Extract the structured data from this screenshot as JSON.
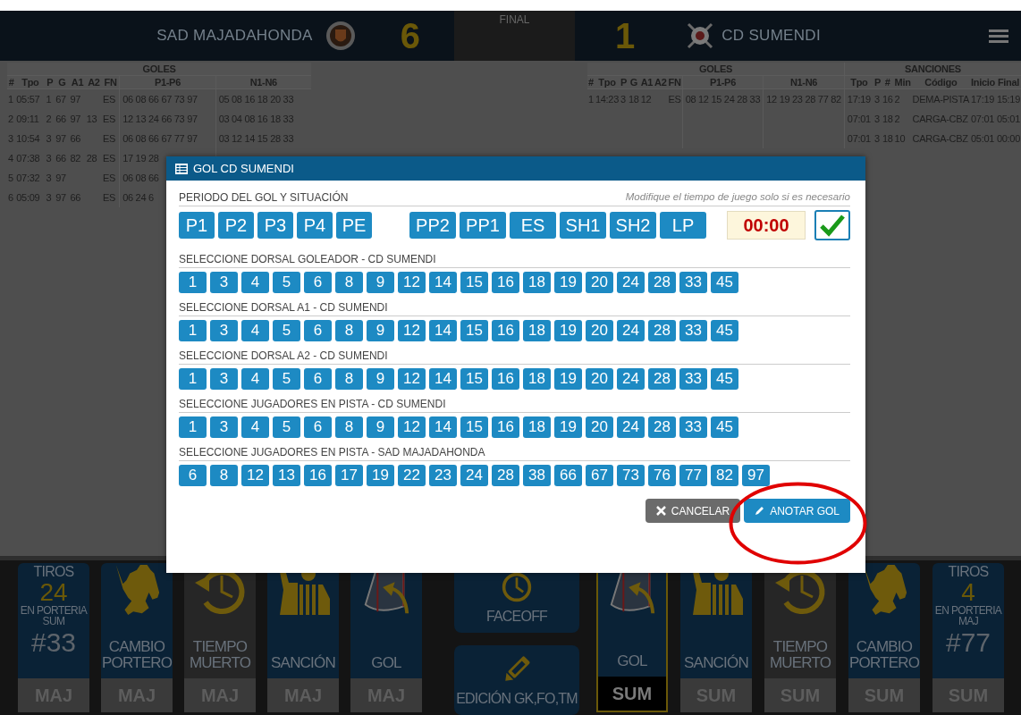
{
  "scoreboard": {
    "home_team": "SAD MAJADAHONDA",
    "home_score": "6",
    "status": "FINAL",
    "away_score": "1",
    "away_team": "CD SUMENDI"
  },
  "home_table": {
    "groups": [
      {
        "label": "GOLES",
        "columns": [
          "#",
          "Tpo",
          "P",
          "G",
          "A1",
          "A2",
          "FN",
          "P1-P6",
          "N1-N6"
        ]
      }
    ],
    "rows": [
      [
        "1",
        "05:57",
        "1",
        "67",
        "97",
        null,
        "ES",
        "06 08 66 67 73 97",
        "05 08 16 18 20 33"
      ],
      [
        "2",
        "09:11",
        "2",
        "66",
        "97",
        "13",
        "ES",
        "12 13 24 66 73 97",
        "03 04 08 16 18 33"
      ],
      [
        "3",
        "10:54",
        "3",
        "97",
        "66",
        null,
        "ES",
        "06 08 66 67 77 97",
        "03 12 14 15 28 33"
      ],
      [
        "4",
        "07:38",
        "3",
        "66",
        "82",
        "28",
        "ES",
        "17 19 28",
        null
      ],
      [
        "5",
        "07:32",
        "3",
        "97",
        null,
        null,
        "ES",
        "06 08 66",
        null
      ],
      [
        "6",
        "05:09",
        "3",
        "97",
        "66",
        null,
        "ES",
        "06 24 6",
        null
      ]
    ]
  },
  "away_table": {
    "groups": [
      {
        "label": "GOLES",
        "columns": [
          "#",
          "Tpo",
          "P",
          "G",
          "A1",
          "A2",
          "FN",
          "P1-P6",
          "N1-N6"
        ]
      },
      {
        "label": "SANCIONES",
        "columns": [
          "Tpo",
          "P",
          "#",
          "Min",
          "Código",
          "Inicio",
          "Final"
        ]
      }
    ],
    "rows": [
      [
        "1",
        "14:23",
        "3",
        "18",
        "12",
        null,
        "ES",
        "08 12 15 24 28 33",
        "12 19 23 28 77 82",
        "17:19",
        "3",
        "16",
        "2",
        "DEMA-PISTA",
        "17:19",
        "15:19"
      ],
      [
        null,
        null,
        null,
        null,
        null,
        null,
        null,
        null,
        null,
        "07:01",
        "3",
        "18",
        "2",
        "CARGA-CBZ",
        "07:01",
        "05:01"
      ],
      [
        null,
        null,
        null,
        null,
        null,
        null,
        null,
        null,
        null,
        "07:01",
        "3",
        "18",
        "10",
        "CARGA-CBZ",
        "05:01",
        "00:00"
      ]
    ]
  },
  "modal": {
    "title": "GOL CD SUMENDI",
    "period_label": "PERIODO DEL GOL Y SITUACIÓN",
    "hint": "Modifique el tiempo de juego solo si es necesario",
    "periods": [
      {
        "label": "P1",
        "selected": false
      },
      {
        "label": "P2",
        "selected": false
      },
      {
        "label": "P3",
        "selected": false
      },
      {
        "label": "P4",
        "selected": false
      },
      {
        "label": "PE",
        "selected": false
      }
    ],
    "situations": [
      {
        "label": "PP2",
        "selected": false
      },
      {
        "label": "PP1",
        "selected": false
      },
      {
        "label": "ES",
        "selected": false
      },
      {
        "label": "SH1",
        "selected": false
      },
      {
        "label": "SH2",
        "selected": false
      },
      {
        "label": "LP",
        "selected": false
      }
    ],
    "time": "00:00",
    "sections": [
      {
        "label": "SELECCIONE DORSAL GOLEADOR - CD SUMENDI",
        "numbers": [
          "1",
          "3",
          "4",
          "5",
          "6",
          "8",
          "9",
          "12",
          "14",
          "15",
          "16",
          "18",
          "19",
          "20",
          "24",
          "28",
          "33",
          "45"
        ]
      },
      {
        "label": "SELECCIONE DORSAL A1 - CD SUMENDI",
        "numbers": [
          "1",
          "3",
          "4",
          "5",
          "6",
          "8",
          "9",
          "12",
          "14",
          "15",
          "16",
          "18",
          "19",
          "20",
          "24",
          "28",
          "33",
          "45"
        ]
      },
      {
        "label": "SELECCIONE DORSAL A2 - CD SUMENDI",
        "numbers": [
          "1",
          "3",
          "4",
          "5",
          "6",
          "8",
          "9",
          "12",
          "14",
          "15",
          "16",
          "18",
          "19",
          "20",
          "24",
          "28",
          "33",
          "45"
        ]
      },
      {
        "label": "SELECCIONE JUGADORES EN PISTA - CD SUMENDI",
        "numbers": [
          "1",
          "3",
          "4",
          "5",
          "6",
          "8",
          "9",
          "12",
          "14",
          "15",
          "16",
          "18",
          "19",
          "20",
          "24",
          "28",
          "33",
          "45"
        ]
      },
      {
        "label": "SELECCIONE JUGADORES EN PISTA - SAD MAJADAHONDA",
        "numbers": [
          "6",
          "8",
          "12",
          "13",
          "16",
          "17",
          "19",
          "22",
          "23",
          "24",
          "28",
          "38",
          "66",
          "67",
          "73",
          "76",
          "77",
          "82",
          "97"
        ]
      }
    ],
    "buttons": [
      {
        "kind": "cancel",
        "label": "CANCELAR"
      },
      {
        "kind": "submit",
        "label": "ANOTAR GOL"
      }
    ]
  },
  "bottom_panel": {
    "left_tiles": [
      {
        "kind": "shots",
        "title": "TIROS",
        "count": "24",
        "subtitle": "EN PORTERIA",
        "goalie_team": "SUM",
        "goalie_number": "#33",
        "team": "MAJ",
        "selected": false
      },
      {
        "kind": "goalie",
        "label": "CAMBIO PORTERO",
        "team": "MAJ",
        "selected": false
      },
      {
        "kind": "timeout",
        "label": "TIEMPO MUERTO",
        "team": "MAJ",
        "selected": false
      },
      {
        "kind": "penalty",
        "label": "SANCIÓN",
        "team": "MAJ",
        "selected": false
      },
      {
        "kind": "goal",
        "label": "GOL",
        "team": "MAJ",
        "selected": false
      }
    ],
    "center_tiles": [
      {
        "kind": "faceoff",
        "label": "FACEOFF"
      },
      {
        "kind": "edit",
        "label": "EDICIÓN GK,FO,TM"
      }
    ],
    "right_tiles": [
      {
        "kind": "goal",
        "label": "GOL",
        "team": "SUM",
        "selected": true
      },
      {
        "kind": "penalty",
        "label": "SANCIÓN",
        "team": "SUM",
        "selected": false
      },
      {
        "kind": "timeout",
        "label": "TIEMPO MUERTO",
        "team": "SUM",
        "selected": false
      },
      {
        "kind": "goalie",
        "label": "CAMBIO PORTERO",
        "team": "SUM",
        "selected": false
      },
      {
        "kind": "shots",
        "title": "TIROS",
        "count": "4",
        "subtitle": "EN PORTERIA",
        "goalie_team": "MAJ",
        "goalie_number": "#77",
        "team": "SUM",
        "selected": false
      }
    ]
  }
}
